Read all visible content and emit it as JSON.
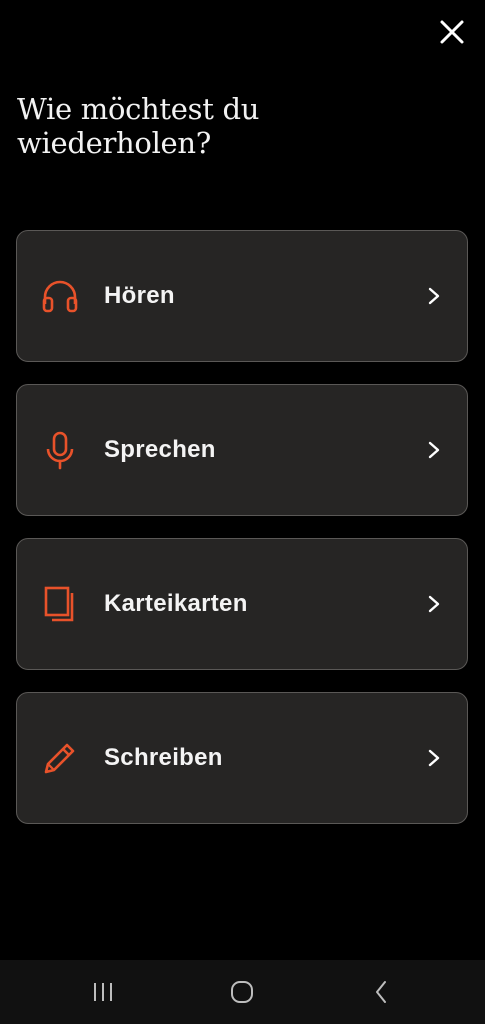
{
  "header": {
    "title_line1": "Wie möchtest du",
    "title_line2": "wiederholen?",
    "close_icon": "close-icon"
  },
  "options": [
    {
      "label": "Hören",
      "icon": "headphones-icon"
    },
    {
      "label": "Sprechen",
      "icon": "microphone-icon"
    },
    {
      "label": "Karteikarten",
      "icon": "flashcards-icon"
    },
    {
      "label": "Schreiben",
      "icon": "pencil-icon"
    }
  ],
  "colors": {
    "background": "#000000",
    "card": "#262524",
    "card_border": "#5a5856",
    "accent": "#e8522a",
    "text": "#f4f4f4"
  },
  "navbar": {
    "buttons": [
      "recent-apps-icon",
      "home-icon",
      "back-icon"
    ]
  }
}
